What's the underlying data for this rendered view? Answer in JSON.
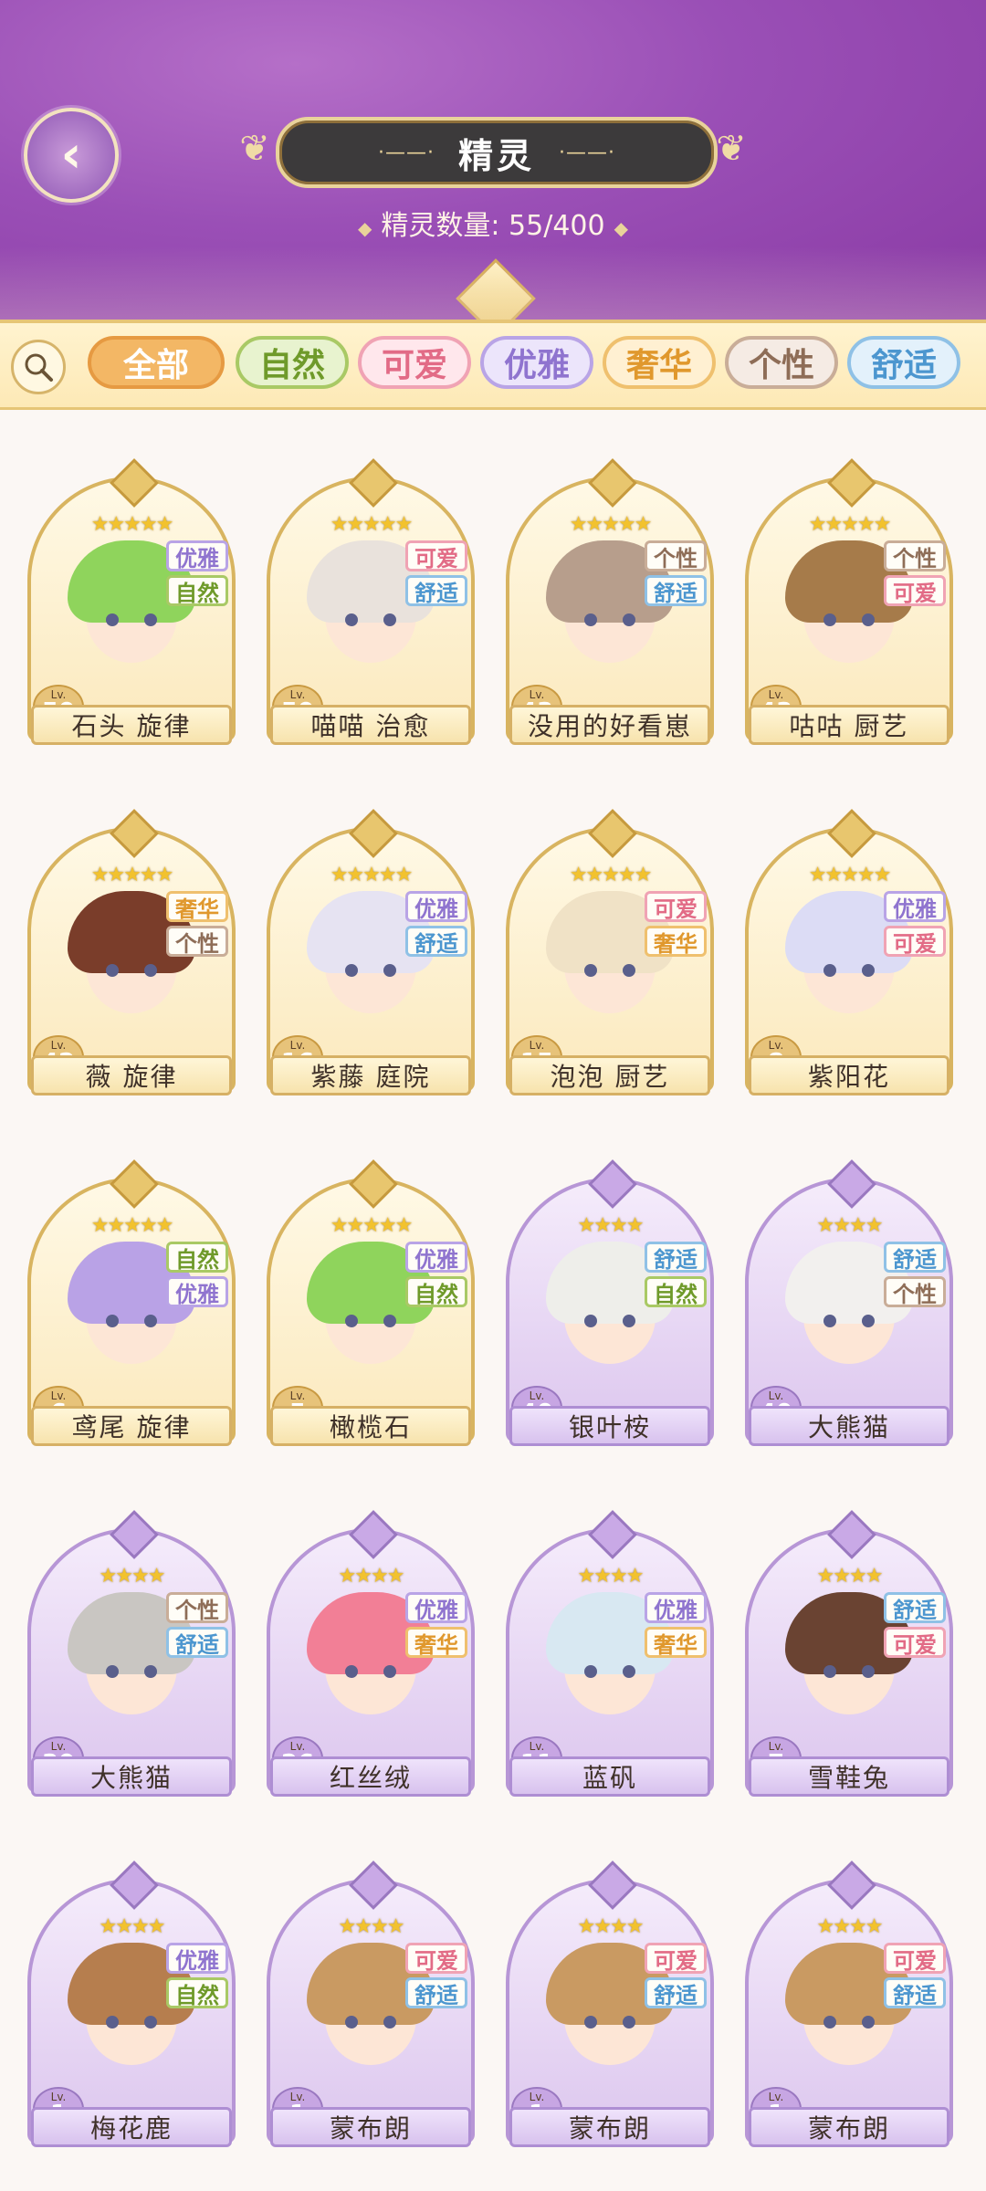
{
  "header": {
    "title": "精灵",
    "title_deco_left": "·——·",
    "title_deco_right": "·——·",
    "count_label": "精灵数量: 55/400",
    "back_icon": "back-leaf-icon"
  },
  "filters": {
    "search_icon": "search-icon",
    "tabs": [
      {
        "label": "全部",
        "bg": "#f3b765",
        "fg": "#ffffff",
        "border": "#e69a42"
      },
      {
        "label": "自然",
        "bg": "#e8f3cf",
        "fg": "#6f9a2a",
        "border": "#a9c965"
      },
      {
        "label": "可爱",
        "bg": "#ffe7ec",
        "fg": "#e26b86",
        "border": "#f0a3b4"
      },
      {
        "label": "优雅",
        "bg": "#ece5fb",
        "fg": "#8f74cf",
        "border": "#b9a4e6"
      },
      {
        "label": "奢华",
        "bg": "#fff0d2",
        "fg": "#e0982d",
        "border": "#efc06e"
      },
      {
        "label": "个性",
        "bg": "#f5ebe4",
        "fg": "#8e6d57",
        "border": "#c9ad98"
      },
      {
        "label": "舒适",
        "bg": "#e3f1fb",
        "fg": "#4c96cf",
        "border": "#8fc1e6"
      }
    ]
  },
  "tag_styles": {
    "优雅": {
      "fg": "#8f74cf",
      "border": "#b9a4e6"
    },
    "自然": {
      "fg": "#6f9a2a",
      "border": "#a9c965"
    },
    "可爱": {
      "fg": "#e26b86",
      "border": "#f0a3b4"
    },
    "舒适": {
      "fg": "#4c96cf",
      "border": "#8fc1e6"
    },
    "个性": {
      "fg": "#8e6d57",
      "border": "#c9ad98"
    },
    "奢华": {
      "fg": "#e0982d",
      "border": "#efc06e"
    }
  },
  "spirits": [
    {
      "name": "石头 旋律",
      "level": 50,
      "stars": 5,
      "tags": [
        "优雅",
        "自然"
      ],
      "frame": "gold",
      "hair": "#8fd45c"
    },
    {
      "name": "喵喵 治愈",
      "level": 50,
      "stars": 5,
      "tags": [
        "可爱",
        "舒适"
      ],
      "frame": "gold",
      "hair": "#e9e2dc"
    },
    {
      "name": "没用的好看崽",
      "level": 43,
      "stars": 5,
      "tags": [
        "个性",
        "舒适"
      ],
      "frame": "gold",
      "hair": "#b79e8c"
    },
    {
      "name": "咕咕 厨艺",
      "level": 43,
      "stars": 5,
      "tags": [
        "个性",
        "可爱"
      ],
      "frame": "gold",
      "hair": "#a67b4a"
    },
    {
      "name": "薇 旋律",
      "level": 42,
      "stars": 5,
      "tags": [
        "奢华",
        "个性"
      ],
      "frame": "gold",
      "hair": "#7a3d2a"
    },
    {
      "name": "紫藤 庭院",
      "level": 16,
      "stars": 5,
      "tags": [
        "优雅",
        "舒适"
      ],
      "frame": "gold",
      "hair": "#e6e3f2"
    },
    {
      "name": "泡泡 厨艺",
      "level": 15,
      "stars": 5,
      "tags": [
        "可爱",
        "奢华"
      ],
      "frame": "gold",
      "hair": "#f0e2c6"
    },
    {
      "name": "紫阳花",
      "level": 8,
      "stars": 5,
      "tags": [
        "优雅",
        "可爱"
      ],
      "frame": "gold",
      "hair": "#dcdcf5"
    },
    {
      "name": "鸢尾 旋律",
      "level": 6,
      "stars": 5,
      "tags": [
        "自然",
        "优雅"
      ],
      "frame": "gold",
      "hair": "#b9a2e6"
    },
    {
      "name": "橄榄石",
      "level": 5,
      "stars": 5,
      "tags": [
        "优雅",
        "自然"
      ],
      "frame": "gold",
      "hair": "#8fd45c"
    },
    {
      "name": "银叶桉",
      "level": 40,
      "stars": 4,
      "tags": [
        "舒适",
        "自然"
      ],
      "frame": "purple",
      "hair": "#eeeeea"
    },
    {
      "name": "大熊猫",
      "level": 40,
      "stars": 4,
      "tags": [
        "舒适",
        "个性"
      ],
      "frame": "purple",
      "hair": "#f2f0ee"
    },
    {
      "name": "大熊猫",
      "level": 30,
      "stars": 4,
      "tags": [
        "个性",
        "舒适"
      ],
      "frame": "purple",
      "hair": "#c9c6c2"
    },
    {
      "name": "红丝绒",
      "level": 26,
      "stars": 4,
      "tags": [
        "优雅",
        "奢华"
      ],
      "frame": "purple",
      "hair": "#f27f96"
    },
    {
      "name": "蓝矾",
      "level": 11,
      "stars": 4,
      "tags": [
        "优雅",
        "奢华"
      ],
      "frame": "purple",
      "hair": "#d8e8f2"
    },
    {
      "name": "雪鞋兔",
      "level": 7,
      "stars": 4,
      "tags": [
        "舒适",
        "可爱"
      ],
      "frame": "purple",
      "hair": "#6a4332"
    },
    {
      "name": "梅花鹿",
      "level": 1,
      "stars": 4,
      "tags": [
        "优雅",
        "自然"
      ],
      "frame": "purple",
      "hair": "#b67e4e"
    },
    {
      "name": "蒙布朗",
      "level": 1,
      "stars": 4,
      "tags": [
        "可爱",
        "舒适"
      ],
      "frame": "purple",
      "hair": "#c99a62"
    },
    {
      "name": "蒙布朗",
      "level": 1,
      "stars": 4,
      "tags": [
        "可爱",
        "舒适"
      ],
      "frame": "purple",
      "hair": "#c99a62"
    },
    {
      "name": "蒙布朗",
      "level": 1,
      "stars": 4,
      "tags": [
        "可爱",
        "舒适"
      ],
      "frame": "purple",
      "hair": "#c99a62"
    }
  ],
  "level_prefix": "Lv."
}
